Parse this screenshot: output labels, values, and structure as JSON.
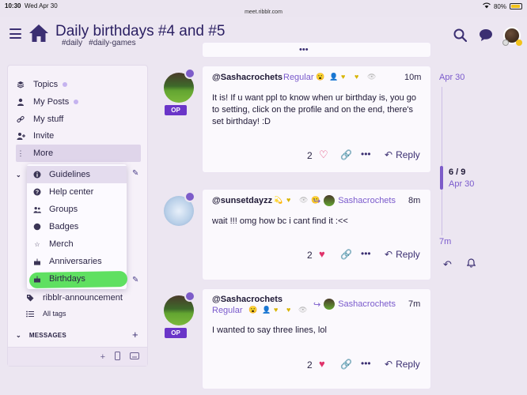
{
  "status_bar": {
    "time": "10:30",
    "date": "Wed Apr 30",
    "url": "meet.ribblr.com",
    "battery": "80%"
  },
  "header": {
    "title": "Daily birthdays #4 and #5",
    "tags": [
      "#daily",
      "#daily-games"
    ]
  },
  "sidebar": {
    "items": [
      {
        "label": "Topics",
        "icon": "layers-icon",
        "dot": true
      },
      {
        "label": "My Posts",
        "icon": "user-icon",
        "dot": true
      },
      {
        "label": "My stuff",
        "icon": "link-icon",
        "dot": false
      },
      {
        "label": "Invite",
        "icon": "user-plus-icon",
        "dot": false
      },
      {
        "label": "More",
        "icon": "vertical-dots-icon",
        "dot": false
      }
    ],
    "tags": {
      "announcement": "ribblr-announcement",
      "all_tags": "All tags"
    },
    "messages_label": "MESSAGES"
  },
  "more_menu": {
    "items": [
      {
        "label": "Guidelines",
        "icon": "info-icon"
      },
      {
        "label": "Help center",
        "icon": "question-icon"
      },
      {
        "label": "Groups",
        "icon": "users-icon"
      },
      {
        "label": "Badges",
        "icon": "badge-icon"
      },
      {
        "label": "Merch",
        "icon": "star-icon"
      },
      {
        "label": "Anniversaries",
        "icon": "cake-icon"
      },
      {
        "label": "Birthdays",
        "icon": "cake-icon"
      }
    ],
    "selected": "Guidelines",
    "highlighted": "Birthdays"
  },
  "posts": [
    {
      "username": "@Sashacrochets",
      "rank": "Regular",
      "time": "10m",
      "op_badge": "OP",
      "text": "It is! If u want ppl to know when ur birthday is, you go to setting, click on the profile and on the end, there's set birthday! :D",
      "likes": "2",
      "liked": false,
      "reply_label": "Reply"
    },
    {
      "username": "@sunsetdayzz",
      "reply_to": "Sashacrochets",
      "time": "8m",
      "text": "wait !!! omg how bc i cant find it :<<",
      "likes": "2",
      "liked": true,
      "reply_label": "Reply"
    },
    {
      "username": "@Sashacrochets",
      "rank": "Regular",
      "reply_to": "Sashacrochets",
      "time": "7m",
      "op_badge": "OP",
      "text": "I wanted to say three lines, lol",
      "likes": "2",
      "liked": true,
      "reply_label": "Reply"
    }
  ],
  "timeline": {
    "top_date": "Apr 30",
    "position": "6 / 9",
    "current_date": "Apr 30",
    "bottom": "7m"
  },
  "colors": {
    "accent": "#7d5cc9",
    "brand": "#2a1f62",
    "heart": "#e0336b",
    "highlight": "#5fe061",
    "background": "#ece6f1"
  }
}
